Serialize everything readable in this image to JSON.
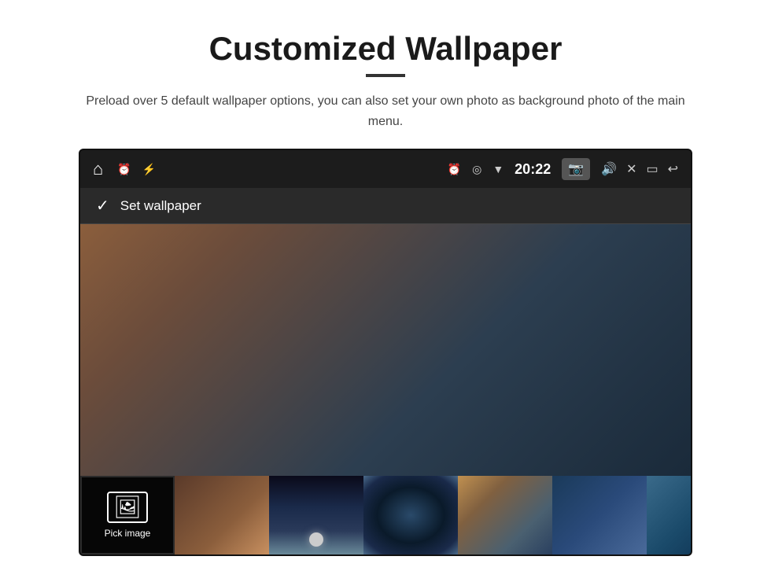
{
  "page": {
    "title": "Customized Wallpaper",
    "subtitle": "Preload over 5 default wallpaper options, you can also set your own photo as background photo of the main menu.",
    "status_bar": {
      "time": "20:22",
      "left_icons": [
        "home",
        "alarm",
        "usb"
      ],
      "right_icons": [
        "alarm",
        "location",
        "wifi",
        "camera",
        "volume",
        "close",
        "window",
        "back"
      ]
    },
    "wallpaper_bar": {
      "check_label": "Set wallpaper"
    },
    "pick_image": {
      "label": "Pick image"
    }
  }
}
